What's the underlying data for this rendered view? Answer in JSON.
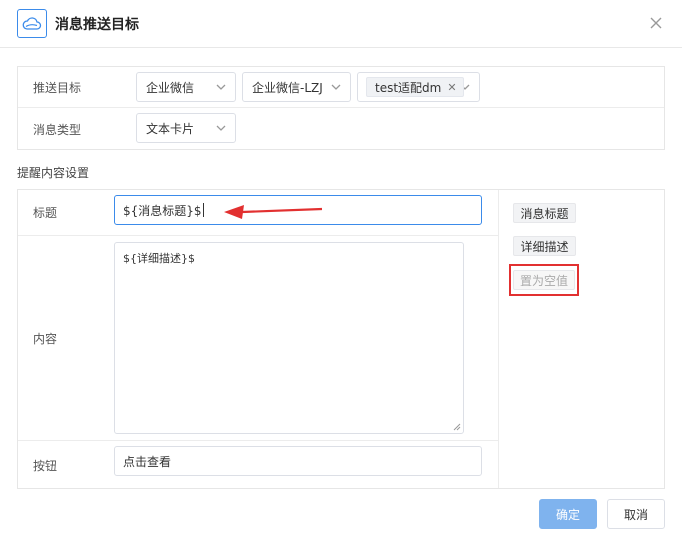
{
  "dialog": {
    "title": "消息推送目标",
    "logo_icon": "cloud-push-icon",
    "close_icon": "close-icon"
  },
  "target": {
    "label": "推送目标",
    "channel": "企业微信",
    "account": "企业微信-LZJ",
    "selected_tag": "test适配dm"
  },
  "message_type": {
    "label": "消息类型",
    "value": "文本卡片"
  },
  "content_section": {
    "title": "提醒内容设置",
    "title_label": "标题",
    "title_value": "${消息标题}$",
    "content_label": "内容",
    "content_value": "${详细描述}$",
    "button_label": "按钮",
    "button_value": "点击查看"
  },
  "variables": {
    "items": [
      "消息标题",
      "详细描述"
    ],
    "clear_label": "置为空值"
  },
  "footer": {
    "confirm": "确定",
    "cancel": "取消"
  },
  "colors": {
    "accent": "#3b8bea",
    "primary_button": "#7fb3ee",
    "annotation_red": "#e23030"
  }
}
